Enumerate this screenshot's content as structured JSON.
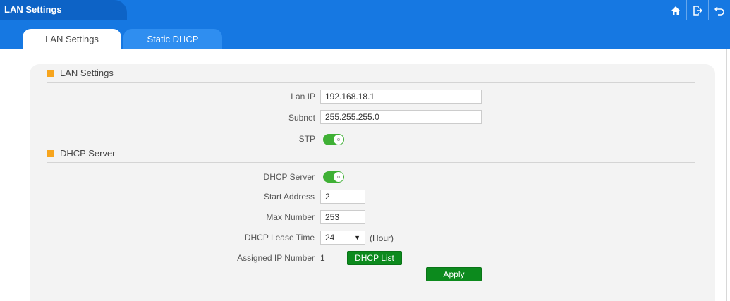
{
  "window": {
    "title": "LAN Settings",
    "icons": [
      "home-icon",
      "logout-icon",
      "back-icon"
    ]
  },
  "tabs": [
    {
      "label": "LAN Settings",
      "active": true
    },
    {
      "label": "Static DHCP",
      "active": false
    }
  ],
  "lan_section": {
    "title": "LAN Settings",
    "lan_ip": {
      "label": "Lan IP",
      "value": "192.168.18.1"
    },
    "subnet": {
      "label": "Subnet",
      "value": "255.255.255.0"
    },
    "stp": {
      "label": "STP",
      "on": true
    }
  },
  "dhcp_section": {
    "title": "DHCP Server",
    "dhcp_server": {
      "label": "DHCP Server",
      "on": true
    },
    "start_address": {
      "label": "Start Address",
      "value": "2"
    },
    "max_number": {
      "label": "Max Number",
      "value": "253"
    },
    "lease_time": {
      "label": "DHCP Lease Time",
      "value": "24",
      "unit": "(Hour)"
    },
    "assigned": {
      "label": "Assigned IP Number",
      "value": "1"
    },
    "dhcp_list_label": "DHCP List"
  },
  "apply_label": "Apply",
  "colors": {
    "title_bar": "#1678e2",
    "accent_orange": "#f7a51e",
    "toggle_green": "#3fb035",
    "button_green": "#0c8a1d"
  }
}
